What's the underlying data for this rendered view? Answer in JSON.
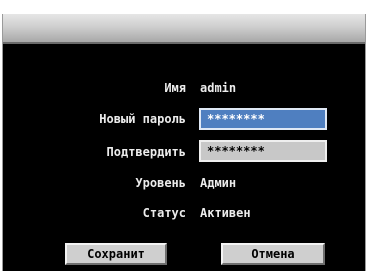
{
  "form": {
    "name_label": "Имя",
    "name_value": "admin",
    "new_password_label": "Новый пароль",
    "new_password_value": "********",
    "confirm_label": "Подтвердить",
    "confirm_value": "********",
    "level_label": "Уровень",
    "level_value": "Админ",
    "status_label": "Статус",
    "status_value": "Активен"
  },
  "buttons": {
    "save_label": "Сохранит",
    "cancel_label": "Отмена"
  },
  "colors": {
    "background": "#000000",
    "focused_field": "#4f7fc0",
    "field": "#c8c8c8",
    "button": "#cfcfcf"
  }
}
